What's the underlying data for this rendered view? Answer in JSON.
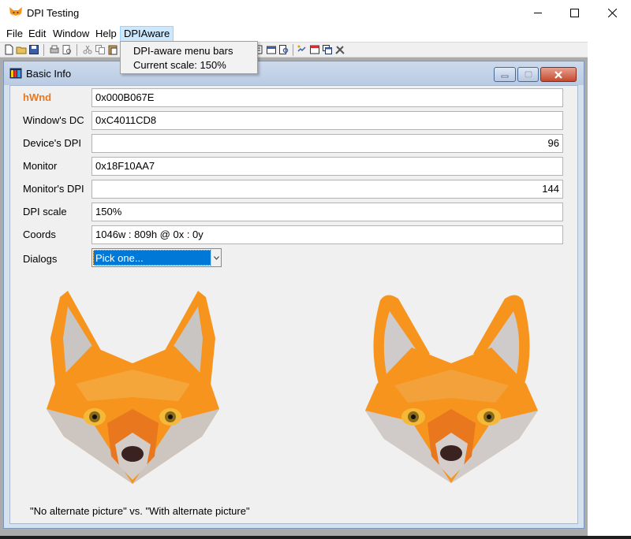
{
  "window": {
    "title": "DPI Testing",
    "controls": {
      "minimize": "minimize",
      "maximize": "maximize",
      "close": "close"
    }
  },
  "menubar": {
    "items": [
      "File",
      "Edit",
      "Window",
      "Help",
      "DPIAware"
    ],
    "active": "DPIAware"
  },
  "dropdown": {
    "items": [
      "DPI-aware menu bars",
      "Current scale: 150%"
    ]
  },
  "toolbar": {
    "icons": [
      "new-icon",
      "open-icon",
      "save-icon",
      "print-icon",
      "print-preview-icon",
      "cut-icon",
      "copy-icon",
      "paste-icon",
      "tool-icon",
      "properties-icon",
      "find-icon",
      "arrange-icon",
      "window-icon",
      "cascade-icon",
      "tools-icon"
    ]
  },
  "child": {
    "title": "Basic Info",
    "rows": [
      {
        "label": "hWnd",
        "value": "0x000B067E",
        "align": "left",
        "accent": true
      },
      {
        "label": "Window's DC",
        "value": "0xC4011CD8",
        "align": "left"
      },
      {
        "label": "Device's DPI",
        "value": "96",
        "align": "right"
      },
      {
        "label": "Monitor",
        "value": "0x18F10AA7",
        "align": "left"
      },
      {
        "label": "Monitor's DPI",
        "value": "144",
        "align": "right"
      },
      {
        "label": "DPI scale",
        "value": "150%",
        "align": "left"
      },
      {
        "label": "Coords",
        "value": "1046w : 809h @ 0x : 0y",
        "align": "left"
      }
    ],
    "dialogs": {
      "label": "Dialogs",
      "selected": "Pick one..."
    },
    "caption": "\"No alternate picture\" vs. \"With alternate picture\""
  },
  "colors": {
    "accent_label": "#e8771e",
    "fox_orange": "#f7941d",
    "selection": "#0078d7"
  }
}
